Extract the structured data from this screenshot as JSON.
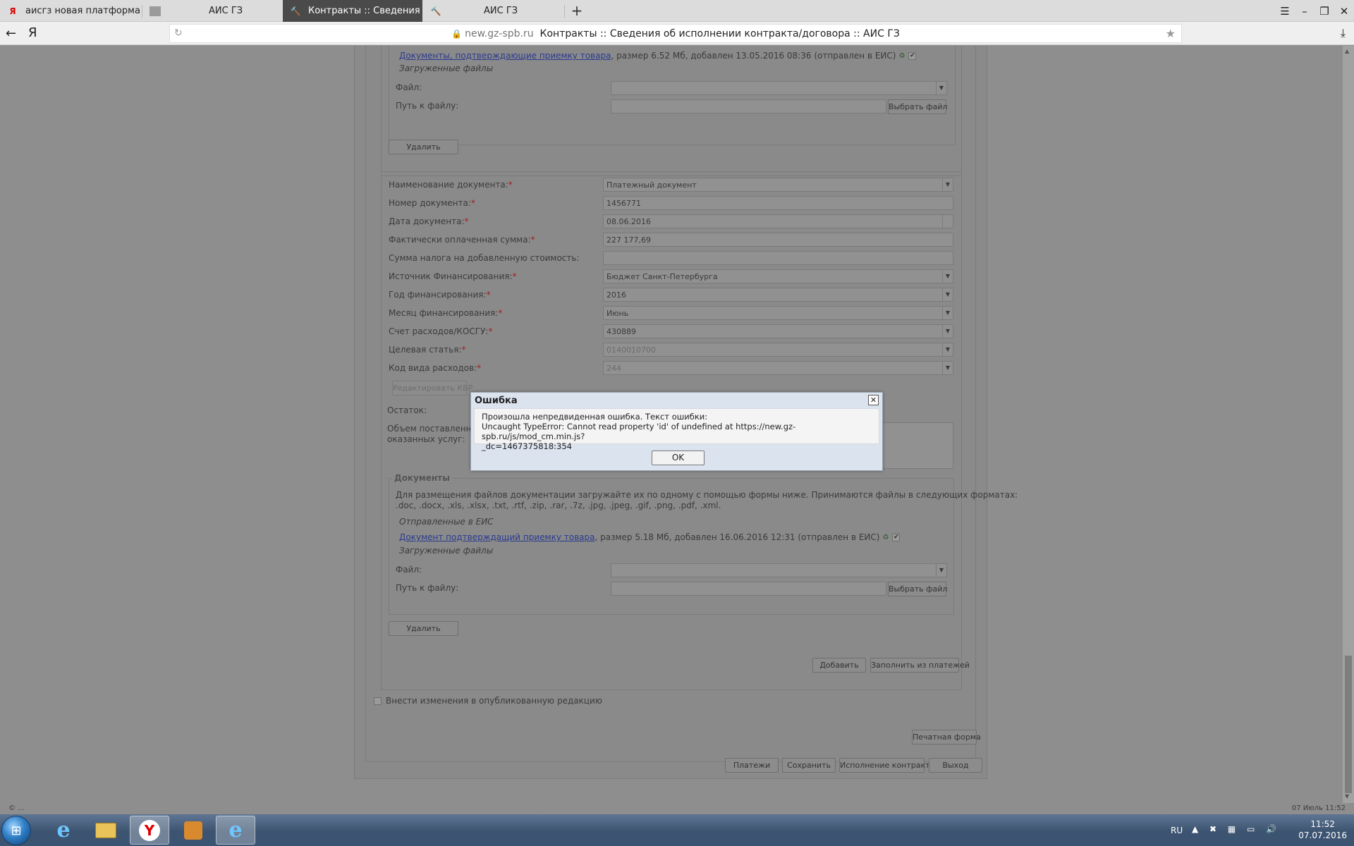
{
  "browser": {
    "tabs": [
      {
        "title": "аисгз новая платформа —",
        "icon": "yandex-icon",
        "active": false
      },
      {
        "title": "АИС ГЗ",
        "icon": "page-icon",
        "active": false
      },
      {
        "title": "Контракты :: Сведения о",
        "icon": "hammer-icon",
        "active": true
      },
      {
        "title": "АИС ГЗ",
        "icon": "hammer-icon",
        "active": false
      }
    ],
    "url_host": "new.gz-spb.ru",
    "url_title": "Контракты :: Сведения об исполнении контракта/договора :: АИС ГЗ",
    "yandex_glyph": "Я"
  },
  "upper_docs": {
    "file_link": "Документы, подтверждающие приемку товара",
    "file_meta": ", размер 6.52 Мб, добавлен 13.05.2016 08:36 (отправлен в ЕИС)",
    "uploaded_label": "Загруженные файлы",
    "file_label": "Файл:",
    "path_label": "Путь к файлу:",
    "choose_file": "Выбрать файл",
    "delete": "Удалить"
  },
  "payment_form": {
    "doc_name_label": "Наименование документа:",
    "doc_name_value": "Платежный документ",
    "doc_number_label": "Номер документа:",
    "doc_number_value": "1456771",
    "doc_date_label": "Дата документа:",
    "doc_date_value": "08.06.2016",
    "paid_sum_label": "Фактически оплаченная сумма:",
    "paid_sum_value": "227 177,69",
    "vat_label": "Сумма налога на добавленную стоимость:",
    "vat_value": "",
    "funding_source_label": "Источник Финансирования:",
    "funding_source_value": "Бюджет Санкт-Петербурга",
    "funding_year_label": "Год финансирования:",
    "funding_year_value": "2016",
    "funding_month_label": "Месяц финансирования:",
    "funding_month_value": "Июнь",
    "account_label": "Счет расходов/КОСГУ:",
    "account_value": "430889",
    "target_label": "Целевая статья:",
    "target_value": "0140010700",
    "expense_code_label": "Код вида расходов:",
    "expense_code_value": "244",
    "edit_kvr": "Редактировать КВР",
    "remainder_label": "Остаток:",
    "volume_label_1": "Объем поставленного",
    "volume_label_2": "оказанных услуг:"
  },
  "lower_docs": {
    "legend": "Документы",
    "instructions_1": "Для размещения файлов документации загружайте их по одному с помощью формы ниже. Принимаются файлы в следующих форматах:",
    "instructions_2": ".doc, .docx, .xls, .xlsx, .txt, .rtf, .zip, .rar, .7z, .jpg, .jpeg, .gif, .png, .pdf, .xml.",
    "sent_label": "Отправленные в ЕИС",
    "file_link": "Документ подтверждащий приемку товара",
    "file_meta": ", размер 5.18 Мб, добавлен 16.06.2016 12:31 (отправлен в ЕИС)",
    "uploaded_label": "Загруженные файлы",
    "file_label": "Файл:",
    "path_label": "Путь к файлу:",
    "choose_file": "Выбрать файл",
    "delete": "Удалить"
  },
  "actions": {
    "add": "Добавить",
    "fill_from_payments": "Заполнить из платежей",
    "publish_changes": "Внести изменения в опубликованную редакцию",
    "print_form": "Печатная форма",
    "payments": "Платежи",
    "save": "Сохранить",
    "contract_execution": "Исполнение контракта",
    "exit": "Выход"
  },
  "dialog": {
    "title": "Ошибка",
    "line1": "Произошла непредвиденная ошибка. Текст ошибки:",
    "line2": "Uncaught TypeError: Cannot read property 'id' of undefined at https://new.gz-spb.ru/js/mod_cm.min.js?",
    "line3": "_dc=1467375818:354",
    "ok": "OK"
  },
  "status": {
    "left": "© ...",
    "right": "07 Июль 11:52"
  },
  "taskbar": {
    "lang": "RU",
    "time": "11:52",
    "date": "07.07.2016"
  },
  "colors": {
    "overlay": "#8e8e8e",
    "dialog_bg": "#dbe3ef",
    "link": "#2b3a8f",
    "required": "#a02020"
  }
}
